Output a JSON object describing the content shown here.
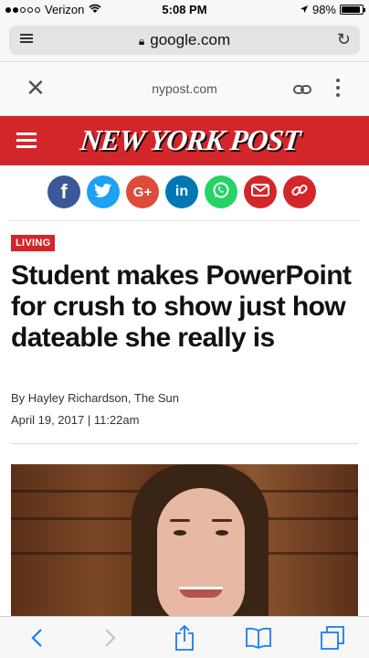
{
  "status_bar": {
    "carrier": "Verizon",
    "time": "5:08 PM",
    "battery": "98%"
  },
  "browser": {
    "url": "google.com"
  },
  "amp_header": {
    "domain": "nypost.com"
  },
  "masthead": {
    "logo": "NEW YORK POST"
  },
  "share": [
    {
      "name": "facebook",
      "glyph": "f",
      "color": "#3b5998"
    },
    {
      "name": "twitter",
      "glyph": "t",
      "color": "#1da1f2"
    },
    {
      "name": "google-plus",
      "glyph": "G+",
      "color": "#dd4b39"
    },
    {
      "name": "linkedin",
      "glyph": "in",
      "color": "#0077b5"
    },
    {
      "name": "whatsapp",
      "glyph": "✆",
      "color": "#25d366"
    },
    {
      "name": "email",
      "glyph": "✉",
      "color": "#d3262a"
    },
    {
      "name": "link",
      "glyph": "⚯",
      "color": "#d3262a"
    }
  ],
  "article": {
    "section": "LIVING",
    "headline": "Student makes PowerPoint for crush to show just how dateable she really is",
    "byline": "By Hayley Richardson, The Sun",
    "date": "April 19, 2017 | 11:22am"
  }
}
